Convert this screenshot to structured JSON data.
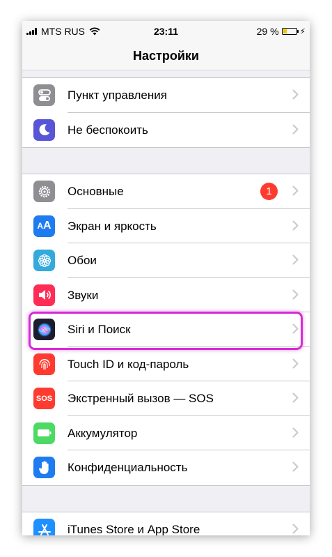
{
  "status_bar": {
    "carrier": "MTS RUS",
    "time": "23:11",
    "battery_percent": "29 %",
    "battery_level": 0.29
  },
  "nav": {
    "title": "Настройки"
  },
  "group1": [
    {
      "label": "Пункт управления",
      "icon": "control-center-icon",
      "color": "#8e8e93"
    },
    {
      "label": "Не беспокоить",
      "icon": "moon-icon",
      "color": "#5856d6"
    }
  ],
  "group2": [
    {
      "label": "Основные",
      "icon": "gear-icon",
      "color": "#8e8e93",
      "badge": "1"
    },
    {
      "label": "Экран и яркость",
      "icon": "text-size-icon",
      "color": "#1e7cf0"
    },
    {
      "label": "Обои",
      "icon": "flower-icon",
      "color": "#34aadc"
    },
    {
      "label": "Звуки",
      "icon": "speaker-icon",
      "color": "#ff2d55"
    },
    {
      "label": "Siri и Поиск",
      "icon": "siri-icon",
      "color": "#1c1c2e"
    },
    {
      "label": "Touch ID и код-пароль",
      "icon": "fingerprint-icon",
      "color": "#ff3b30"
    },
    {
      "label": "Экстренный вызов — SOS",
      "icon": "sos-icon",
      "color": "#ff3b30",
      "icon_text": "SOS"
    },
    {
      "label": "Аккумулятор",
      "icon": "battery-icon",
      "color": "#4cd964"
    },
    {
      "label": "Конфиденциальность",
      "icon": "hand-icon",
      "color": "#1e7cf0"
    }
  ],
  "group3": [
    {
      "label": "iTunes Store и App Store",
      "icon": "app-store-icon",
      "color": "#1e90ff"
    }
  ],
  "colors": {
    "highlight": "#d62ad6",
    "badge": "#ff3b30"
  }
}
